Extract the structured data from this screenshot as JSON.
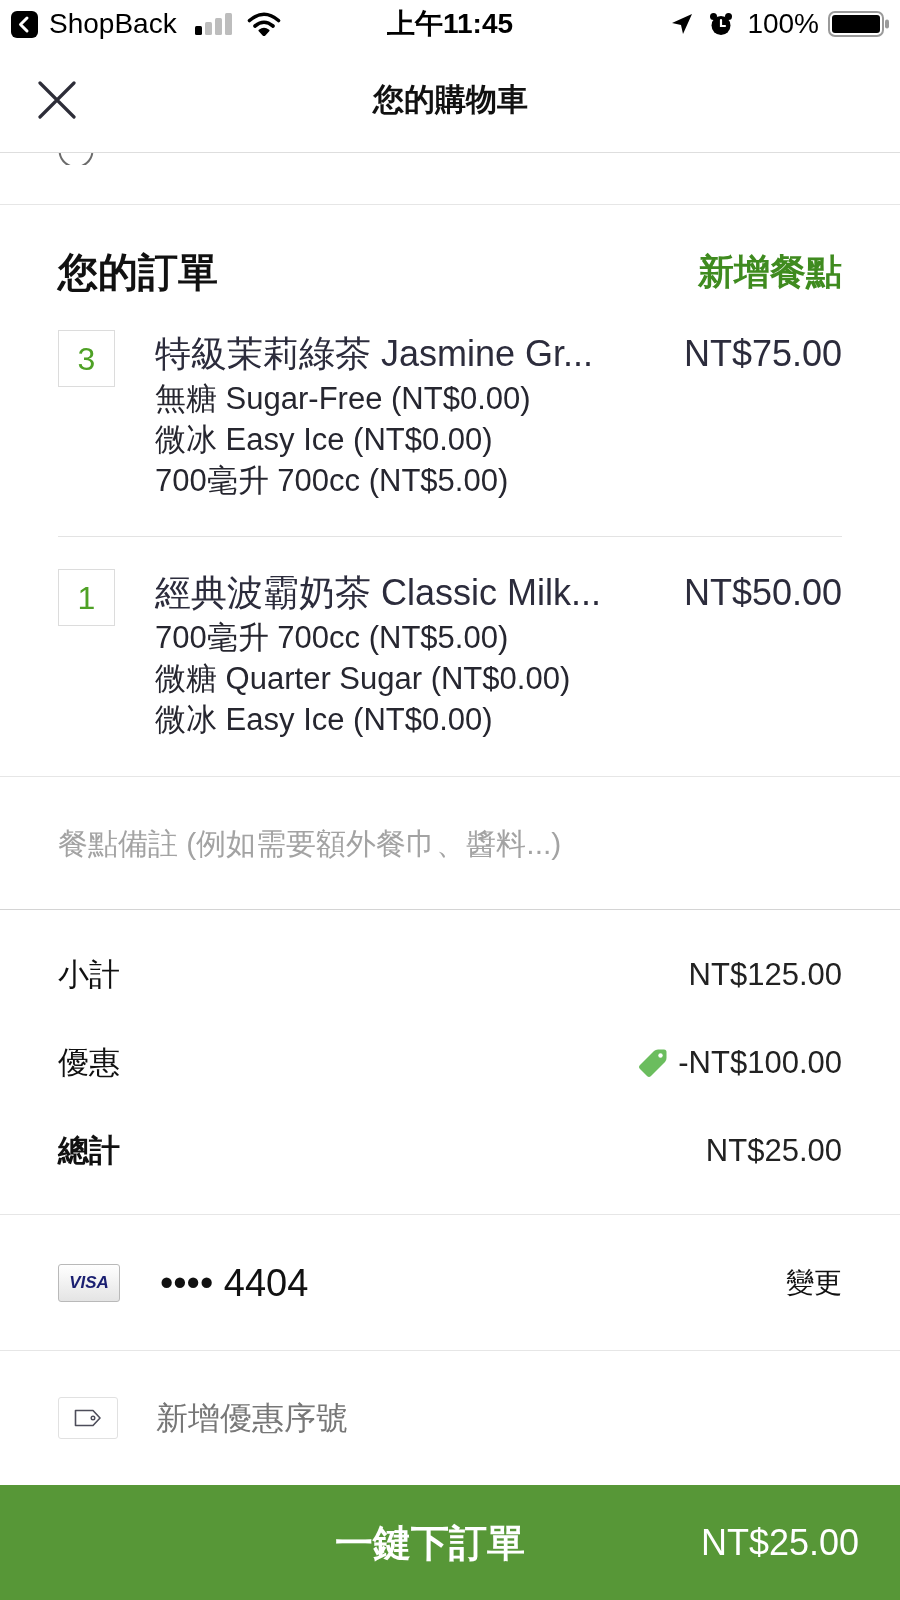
{
  "status_bar": {
    "back_app": "ShopBack",
    "time": "上午11:45",
    "battery": "100%"
  },
  "header": {
    "title": "您的購物車"
  },
  "order": {
    "heading": "您的訂單",
    "add_items": "新增餐點",
    "items": [
      {
        "quantity": "3",
        "name": "特級茉莉綠茶 Jasmine Gr...",
        "price": "NT$75.00",
        "options": [
          "無糖 Sugar-Free (NT$0.00)",
          "微冰 Easy Ice (NT$0.00)",
          "700毫升 700cc (NT$5.00)"
        ]
      },
      {
        "quantity": "1",
        "name": "經典波霸奶茶 Classic Milk...",
        "price": "NT$50.00",
        "options": [
          "700毫升 700cc (NT$5.00)",
          "微糖 Quarter Sugar (NT$0.00)",
          "微冰 Easy Ice (NT$0.00)"
        ]
      }
    ]
  },
  "notes": {
    "placeholder": "餐點備註 (例如需要額外餐巾、醬料...)"
  },
  "summary": [
    {
      "kind": "subtotal",
      "label": "小計",
      "value": "NT$125.00"
    },
    {
      "kind": "discount",
      "label": "優惠",
      "value": "-NT$100.00"
    },
    {
      "kind": "total",
      "label": "總計",
      "value": "NT$25.00"
    }
  ],
  "payment": {
    "card_brand": "VISA",
    "card_number": "•••• 4404",
    "change": "變更"
  },
  "promo": {
    "label": "新增優惠序號"
  },
  "checkout": {
    "label": "一鍵下訂單",
    "total": "NT$25.00"
  }
}
